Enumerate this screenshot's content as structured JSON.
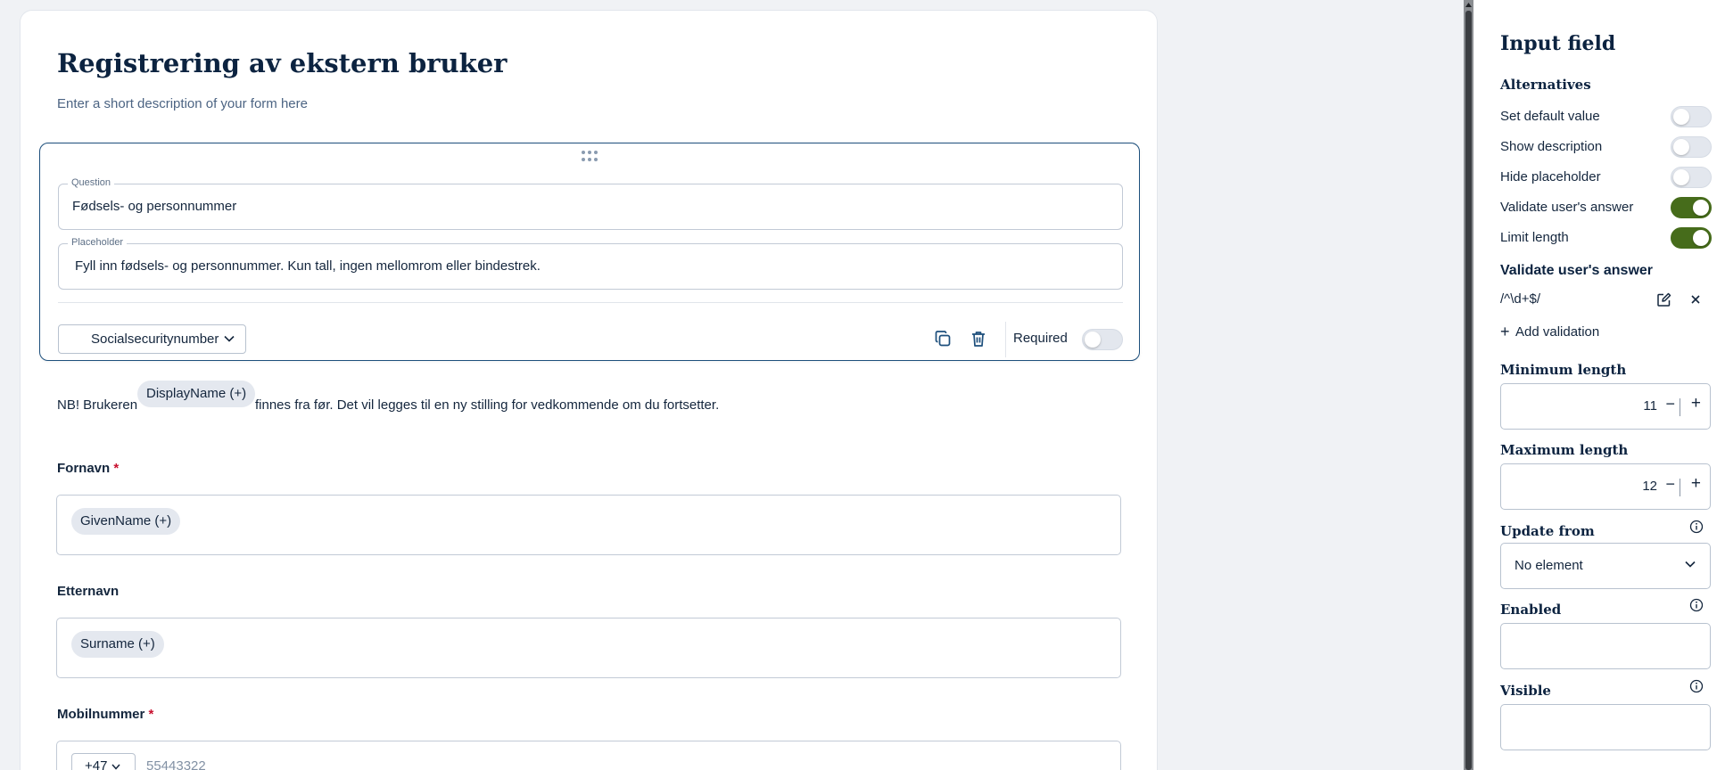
{
  "form": {
    "title": "Registrering av ekstern bruker",
    "description": "Enter a short description of your form here"
  },
  "editor": {
    "question_legend": "Question",
    "question_value": "Fødsels- og personnummer",
    "placeholder_legend": "Placeholder",
    "placeholder_value": "Fyll inn fødsels- og personnummer. Kun tall, ingen mellomrom eller bindestrek.",
    "type_value": "Socialsecuritynumber",
    "required_label": "Required",
    "required_on": false
  },
  "notice": {
    "prefix": "NB! Brukeren",
    "chip": "DisplayName (+)",
    "suffix": "finnes fra før. Det vil legges til en ny stilling for vedkommende om du fortsetter."
  },
  "fields": [
    {
      "label": "Fornavn",
      "required": "*",
      "chip": "GivenName (+)"
    },
    {
      "label": "Etternavn",
      "required": "",
      "chip": "Surname (+)"
    },
    {
      "label": "Mobilnummer",
      "required": "*",
      "country_code": "+47",
      "placeholder": "55443322"
    }
  ],
  "panel": {
    "title": "Input field",
    "alternatives_heading": "Alternatives",
    "options": [
      {
        "label": "Set default value",
        "on": false
      },
      {
        "label": "Show description",
        "on": false
      },
      {
        "label": "Hide placeholder",
        "on": false
      },
      {
        "label": "Validate user's answer",
        "on": true
      },
      {
        "label": "Limit length",
        "on": true
      }
    ],
    "validate_heading": "Validate user's answer",
    "regex": "/^\\d+$/",
    "add_validation": "Add validation",
    "min_length_label": "Minimum length",
    "min_length_value": "11",
    "max_length_label": "Maximum length",
    "max_length_value": "12",
    "update_from_label": "Update from",
    "update_from_value": "No element",
    "enabled_label": "Enabled",
    "visible_label": "Visible"
  },
  "colors": {
    "accent_green": "#466c1b",
    "editor_border": "#1d4f7c",
    "required_star": "#c8102e"
  }
}
